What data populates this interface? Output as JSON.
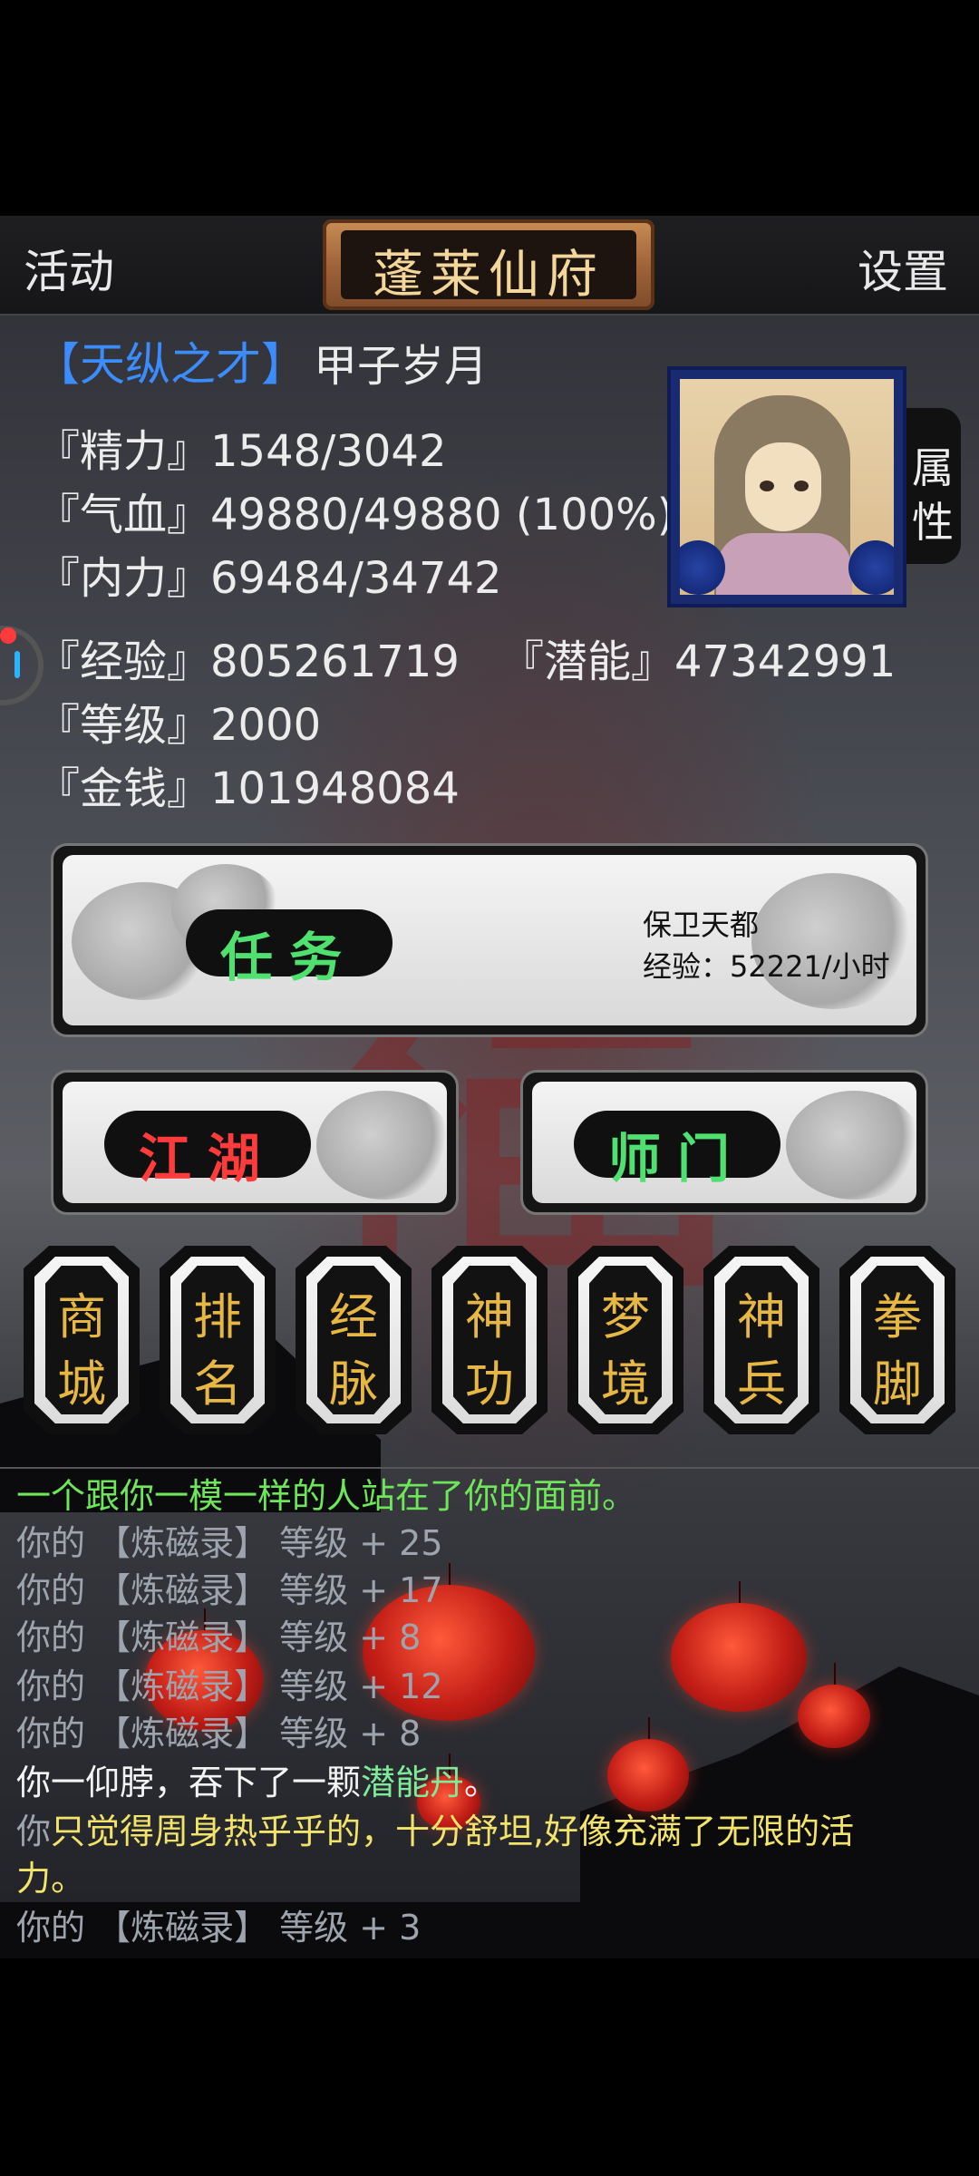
{
  "topbar": {
    "activity_label": "活动",
    "title": "蓬莱仙府",
    "settings_label": "设置"
  },
  "character": {
    "title_tag": "【天纵之才】",
    "name": "甲子岁月",
    "attr_tab": [
      "属",
      "性"
    ],
    "stats": {
      "energy": "『精力』1548/3042",
      "hp": "『气血』49880/49880 (100%)",
      "mp": "『内力』69484/34742",
      "exp": "『经验』805261719",
      "potential": "『潜能』47342991",
      "level": "『等级』2000",
      "money": "『金钱』101948084"
    }
  },
  "task_panel": {
    "label": "任务",
    "quest_name": "保卫天都",
    "exp_rate": "经验：52221/小时"
  },
  "jianghu_panel": {
    "label": "江湖"
  },
  "shimen_panel": {
    "label": "师门"
  },
  "menu": [
    {
      "top": "商",
      "bottom": "城"
    },
    {
      "top": "排",
      "bottom": "名"
    },
    {
      "top": "经",
      "bottom": "脉"
    },
    {
      "top": "神",
      "bottom": "功"
    },
    {
      "top": "梦",
      "bottom": "境"
    },
    {
      "top": "神",
      "bottom": "兵"
    },
    {
      "top": "拳",
      "bottom": "脚"
    }
  ],
  "log": {
    "l1": "一个跟你一模一样的人站在了你的面前。",
    "l2": "你的 【炼磁录】 等级 + 25",
    "l3": "你的 【炼磁录】 等级 + 17",
    "l4": "你的 【炼磁录】 等级 + 8",
    "l5": "你的 【炼磁录】 等级 + 12",
    "l6": "你的 【炼磁录】 等级 + 8",
    "l7a": "你一仰脖，吞下了一颗",
    "l7b": "潜能丹",
    "l7c": "。",
    "l8a": "你",
    "l8b": "只觉得周身热乎乎的，十分舒坦,好像充满了无限的活",
    "l9": "力。",
    "l10": "你的 【炼磁录】 等级 + 3"
  },
  "colors": {
    "title_tag": "#3b8cff",
    "task_label": "#4fe070",
    "jianghu_label": "#ff3b3b",
    "shimen_label": "#4fe070",
    "menu_text": "#e7b743"
  }
}
